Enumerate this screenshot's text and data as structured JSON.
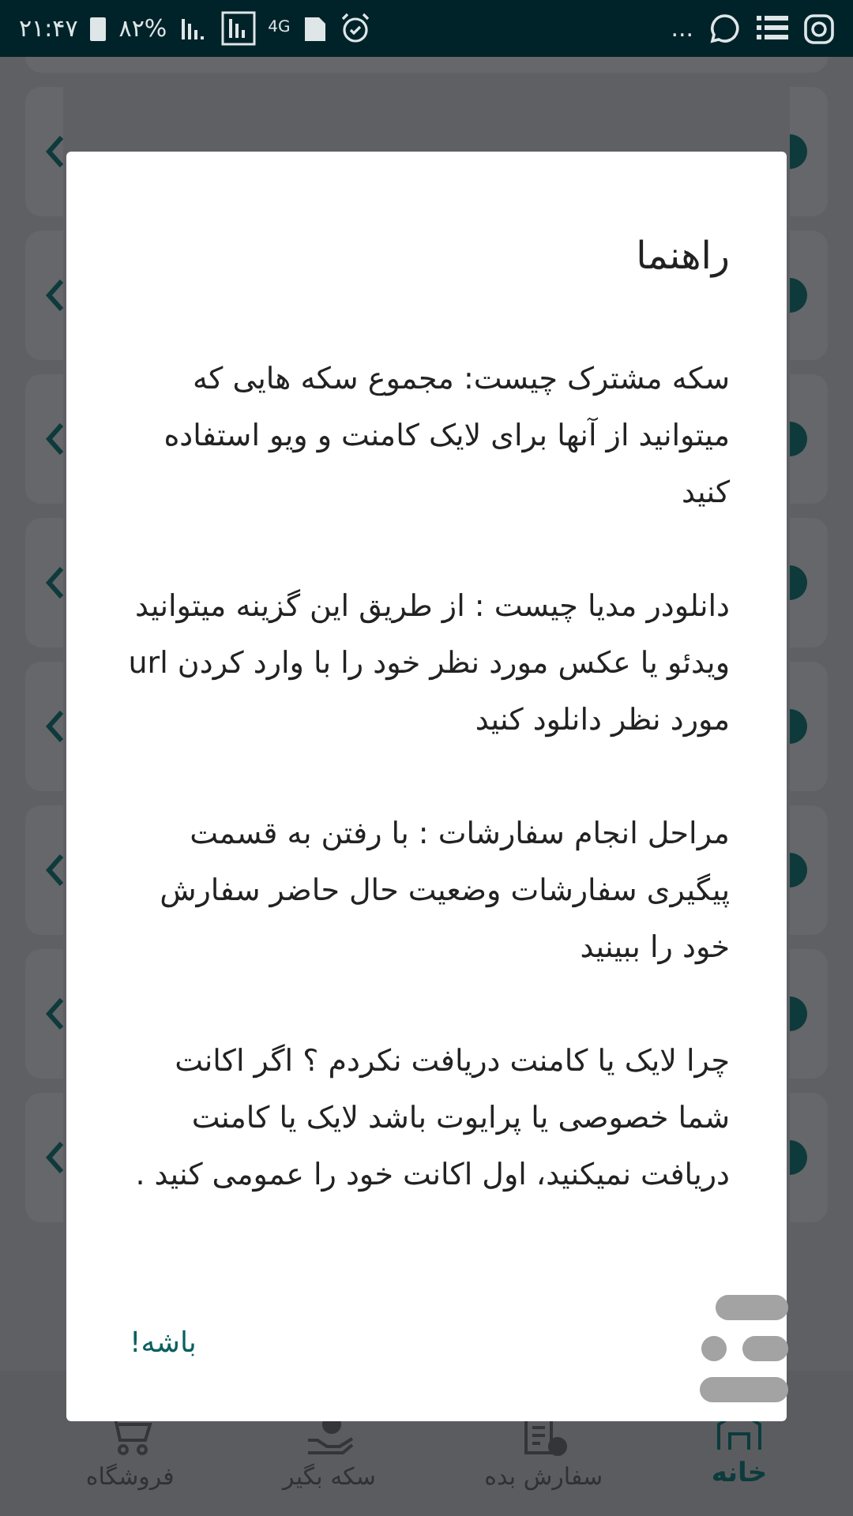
{
  "status_bar": {
    "time": "۲۱:۴۷",
    "battery": "۸۲%",
    "network": "4G",
    "more": "..."
  },
  "dialog": {
    "title": "راهنما",
    "paragraphs": [
      "سکه مشترک چیست: مجموع سکه هایی که میتوانید از آنها برای لایک کامنت و ویو استفاده کنید",
      "دانلودر مدیا چیست : از طریق این گزینه میتوانید ویدئو یا عکس مورد نظر خود را با وارد کردن url مورد نظر دانلود کنید",
      "مراحل انجام سفارشات : با رفتن به قسمت پیگیری سفارشات وضعیت حال حاضر سفارش خود را ببینید",
      "چرا لایک یا کامنت دریافت نکردم ؟ اگر اکانت شما خصوصی یا پرایوت باشد لایک یا کامنت دریافت نمیکنید، اول اکانت خود را عمومی کنید ."
    ],
    "button": "باشه!"
  },
  "bottom_nav": [
    {
      "label": "خانه",
      "selected": true
    },
    {
      "label": "سفارش بده",
      "selected": false
    },
    {
      "label": "سکه بگیر",
      "selected": false
    },
    {
      "label": "فروشگاه",
      "selected": false
    }
  ]
}
